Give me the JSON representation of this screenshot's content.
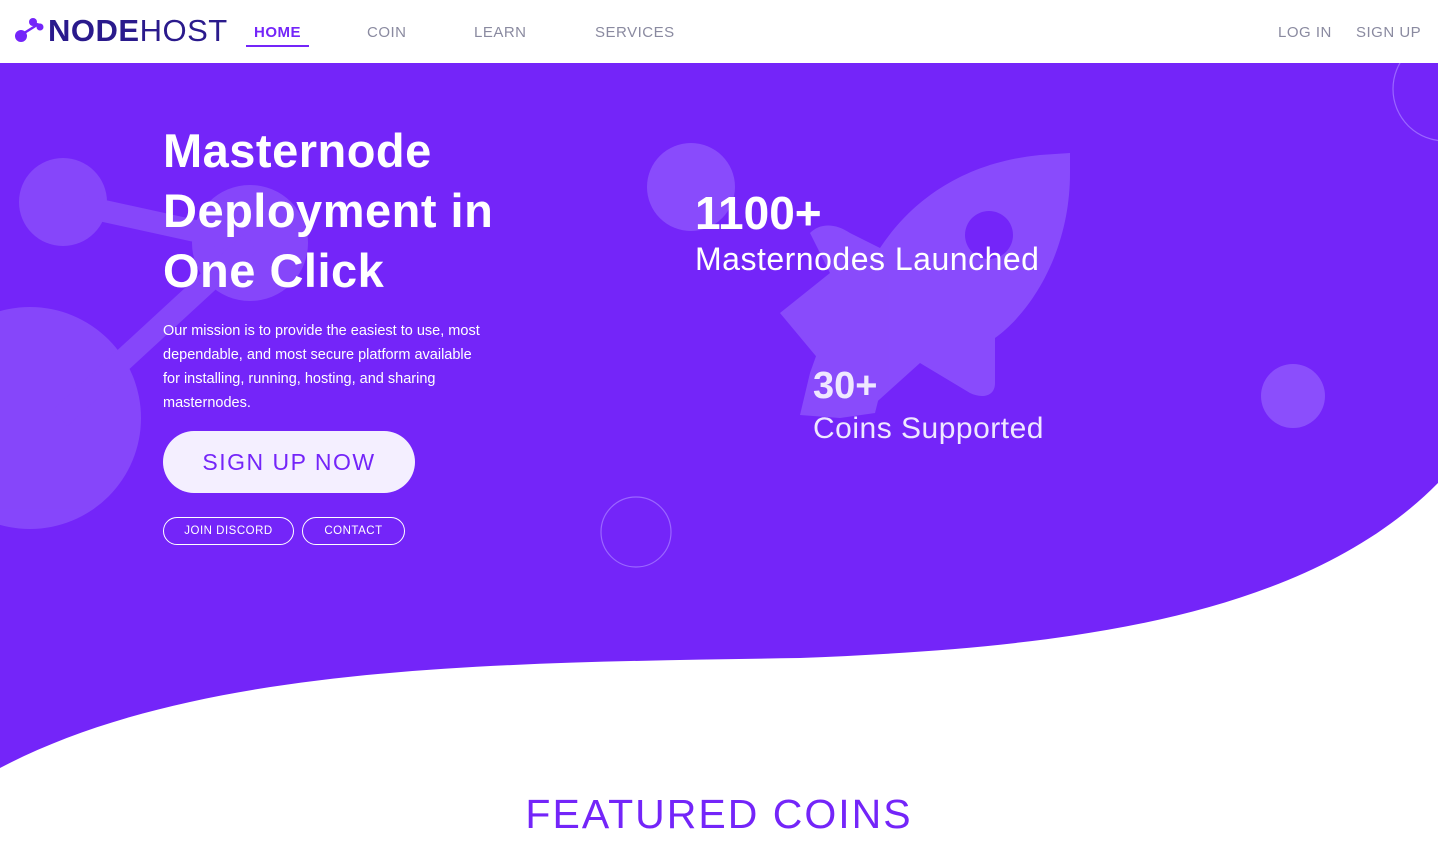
{
  "brand": {
    "name_bold": "NODE",
    "name_light": "HOST",
    "color": "#7425f9",
    "dark": "#2a1a8c"
  },
  "nav": {
    "items": [
      {
        "label": "HOME",
        "active": true
      },
      {
        "label": "COIN",
        "active": false
      },
      {
        "label": "LEARN",
        "active": false
      },
      {
        "label": "SERVICES",
        "active": false
      }
    ],
    "login_label": "LOG IN",
    "signup_label": "SIGN UP"
  },
  "hero": {
    "title": "Masternode Deployment in One Click",
    "description": "Our mission is to provide the easiest to use, most dependable, and most secure platform available for installing, running, hosting, and sharing masternodes.",
    "cta_label": "SIGN UP NOW",
    "discord_label": "JOIN DISCORD",
    "contact_label": "CONTACT",
    "background_color": "#7425f9",
    "decoration_icons": [
      "network-nodes-icon",
      "rocket-icon"
    ]
  },
  "stats": [
    {
      "value": "1100+",
      "label": "Masternodes Launched"
    },
    {
      "value": "30+",
      "label": "Coins Supported"
    }
  ],
  "featured": {
    "title": "FEATURED COINS"
  }
}
